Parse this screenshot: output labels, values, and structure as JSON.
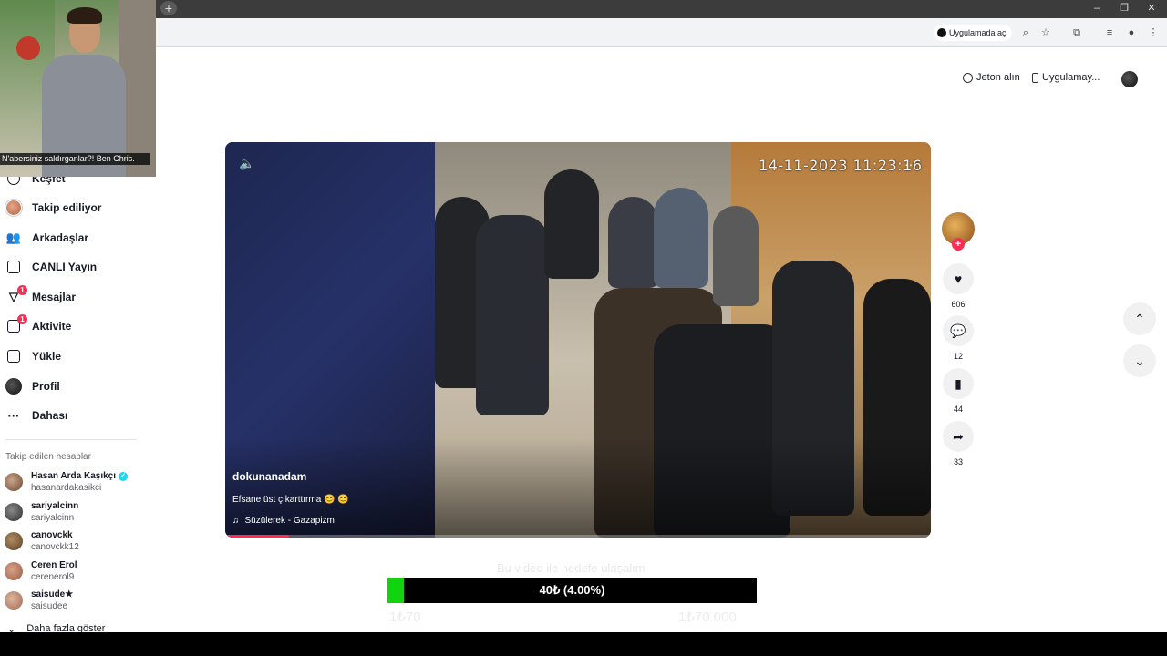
{
  "browser": {
    "open_in_app_label": "Uygulamada aç",
    "new_tab_icon": "plus-icon",
    "window_controls": [
      "–",
      "❐",
      "✕"
    ]
  },
  "webcam": {
    "caption": "N'abersiniz saldırganlar?! Ben Chris."
  },
  "header": {
    "coins_label": "Jeton alın",
    "app_label": "Uygulamay..."
  },
  "sidebar": {
    "items": [
      {
        "label": "Keşfet",
        "icon": "compass-icon",
        "badge": ""
      },
      {
        "label": "Takip ediliyor",
        "icon": "following-avatar-icon",
        "badge": ""
      },
      {
        "label": "Arkadaşlar",
        "icon": "friends-icon",
        "badge": ""
      },
      {
        "label": "CANLI Yayın",
        "icon": "live-tv-icon",
        "badge": ""
      },
      {
        "label": "Mesajlar",
        "icon": "messages-icon",
        "badge": "1"
      },
      {
        "label": "Aktivite",
        "icon": "activity-icon",
        "badge": "1"
      },
      {
        "label": "Yükle",
        "icon": "upload-icon",
        "badge": ""
      },
      {
        "label": "Profil",
        "icon": "profile-icon",
        "badge": ""
      },
      {
        "label": "Dahası",
        "icon": "more-icon",
        "badge": ""
      }
    ],
    "following_title": "Takip edilen hesaplar",
    "accounts": [
      {
        "name": "Hasan Arda Kaşıkçı",
        "handle": "hasanardakasikci",
        "verified": true
      },
      {
        "name": "sariyalcinn",
        "handle": "sariyalcinn",
        "verified": false
      },
      {
        "name": "canovckk",
        "handle": "canovckk12",
        "verified": false
      },
      {
        "name": "Ceren Erol",
        "handle": "cerenerol9",
        "verified": false
      },
      {
        "name": "saisude★",
        "handle": "saisudee",
        "verified": false
      }
    ],
    "show_more": "Daha fazla göster"
  },
  "video": {
    "timestamp": "14-11-2023 11:23:16",
    "author": "dokunanadam",
    "description": "Efsane üst çıkarttırma 😊 😊",
    "music": "Süzülerek - Gazapizm",
    "progress": 0.09
  },
  "actions": {
    "likes": "606",
    "comments": "12",
    "saves": "44",
    "shares": "33"
  },
  "goal": {
    "ghost_title": "Bu video ile hedefe ulaşalım",
    "label": "40₺ (4.00%)",
    "fraction": 0.04,
    "min_label": "1₺70",
    "max_label": "1₺70.000"
  },
  "colors": {
    "accent": "#fe2c55",
    "goal_green": "#12d40e",
    "verified": "#20d5ec"
  }
}
